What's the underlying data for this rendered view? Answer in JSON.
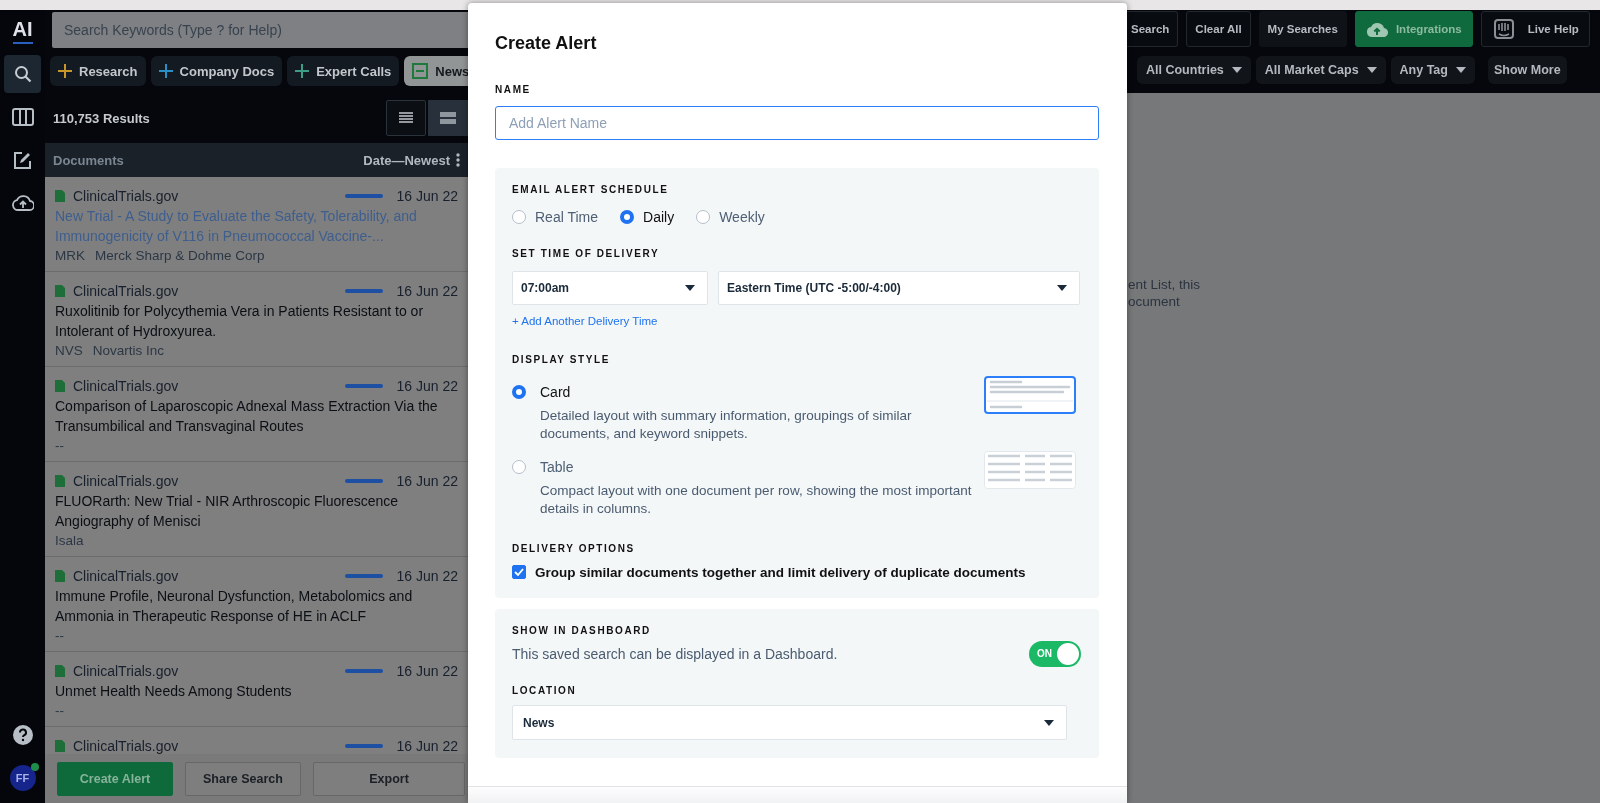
{
  "nav_rail": {
    "logo": "AI",
    "items": [
      {
        "selected": true
      },
      {
        "selected": false
      },
      {
        "selected": false
      },
      {
        "selected": false
      }
    ],
    "avatar": {
      "initials": "FF",
      "online": true
    }
  },
  "search": {
    "placeholder": "Search Keywords (Type ? for Help)"
  },
  "source_filters": [
    {
      "label": "Research",
      "selected": false,
      "color": "#c9952a"
    },
    {
      "label": "Company Docs",
      "selected": false,
      "color": "#2a8fc4"
    },
    {
      "label": "Expert Calls",
      "selected": false,
      "color": "#3c9e87"
    },
    {
      "label": "News",
      "selected": true,
      "color": "#1e7a3c"
    }
  ],
  "results": {
    "count": "110,753 Results",
    "views": [
      {
        "selected": true
      },
      {
        "selected": false
      }
    ]
  },
  "list_header": {
    "title": "Documents",
    "sort": "Date—Newest"
  },
  "documents": [
    {
      "source": "ClinicalTrials.gov",
      "date": "16 Jun 22",
      "title": "New Trial - A Study to Evaluate the Safety, Tolerability, and Immunogenicity of V116 in Pneumococcal Vaccine-...",
      "visited": true,
      "ticker": "MRK",
      "company": "Merck Sharp & Dohme Corp"
    },
    {
      "source": "ClinicalTrials.gov",
      "date": "16 Jun 22",
      "title": "Ruxolitinib for Polycythemia Vera in Patients Resistant to or Intolerant of Hydroxyurea.",
      "visited": false,
      "ticker": "NVS",
      "company": "Novartis Inc"
    },
    {
      "source": "ClinicalTrials.gov",
      "date": "16 Jun 22",
      "title": "Comparison of Laparoscopic Adnexal Mass Extraction Via the Transumbilical and Transvaginal Routes",
      "visited": false,
      "company": "--"
    },
    {
      "source": "ClinicalTrials.gov",
      "date": "16 Jun 22",
      "title": "FLUORarth: New Trial - NIR Arthroscopic Fluorescence Angiography of Menisci",
      "visited": false,
      "company": "Isala"
    },
    {
      "source": "ClinicalTrials.gov",
      "date": "16 Jun 22",
      "title": "Immune Profile, Neuronal Dysfunction, Metabolomics and Ammonia in Therapeutic Response of HE in ACLF",
      "visited": false,
      "company": "--"
    },
    {
      "source": "ClinicalTrials.gov",
      "date": "16 Jun 22",
      "title": "Unmet Health Needs Among Students",
      "visited": false,
      "company": "--"
    },
    {
      "source": "ClinicalTrials.gov",
      "date": "16 Jun 22"
    }
  ],
  "bottom_actions": [
    {
      "label": "Create Alert",
      "kind": "primary"
    },
    {
      "label": "Share Search",
      "kind": "secondary"
    },
    {
      "label": "Export",
      "kind": "secondary"
    }
  ],
  "top_actions": [
    {
      "label": "Search",
      "kind": "cut"
    },
    {
      "label": "Clear All",
      "kind": "outline"
    },
    {
      "label": "My Searches",
      "kind": "plain"
    },
    {
      "label": "Integrations",
      "kind": "integrations"
    },
    {
      "label": "Live Help",
      "kind": "help"
    }
  ],
  "filter_dropdowns": [
    "All Countries",
    "All Market Caps",
    "Any Tag"
  ],
  "show_more": "Show More",
  "background_text": [
    "ent List, this",
    "ocument"
  ],
  "dialog": {
    "title": "Create Alert",
    "name_field": {
      "label": "NAME",
      "placeholder": "Add Alert Name",
      "focused": true
    },
    "schedule": {
      "label": "EMAIL ALERT SCHEDULE",
      "options": [
        {
          "label": "Real Time",
          "selected": false
        },
        {
          "label": "Daily",
          "selected": true
        },
        {
          "label": "Weekly",
          "selected": false
        }
      ]
    },
    "delivery_time": {
      "label": "SET TIME OF DELIVERY",
      "time": "07:00am",
      "timezone": "Eastern Time (UTC -5:00/-4:00)",
      "add_link": "+ Add Another Delivery Time"
    },
    "display_style": {
      "label": "DISPLAY STYLE",
      "options": [
        {
          "kind": "card",
          "label": "Card",
          "description": "Detailed layout with summary information, groupings of similar documents, and keyword snippets.",
          "selected": true
        },
        {
          "kind": "table",
          "label": "Table",
          "description": "Compact layout with one document per row, showing the most important details in columns.",
          "selected": false
        }
      ]
    },
    "delivery_options": {
      "label": "DELIVERY OPTIONS",
      "checkbox": {
        "label": "Group similar documents together and limit delivery of duplicate documents",
        "checked": true
      }
    },
    "dashboard": {
      "label": "SHOW IN DASHBOARD",
      "description": "This saved search can be displayed in a Dashboard.",
      "toggle": {
        "text": "ON",
        "on": true
      },
      "location_label": "LOCATION",
      "location": "News"
    }
  }
}
